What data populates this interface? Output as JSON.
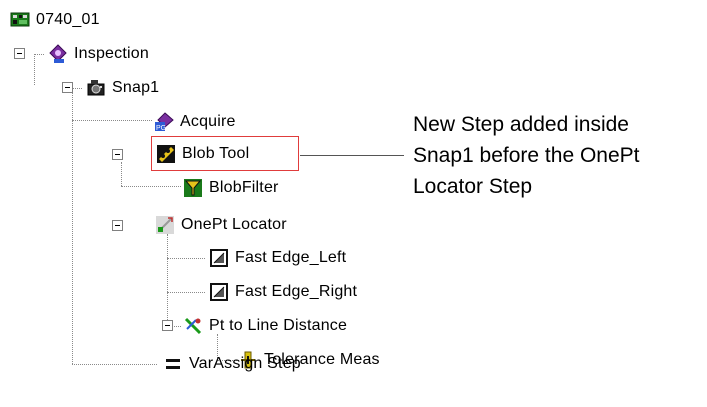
{
  "tree": {
    "root": {
      "label": "0740_01",
      "icon": "board-icon"
    },
    "inspection": {
      "label": "Inspection",
      "icon": "inspection-icon"
    },
    "snap1": {
      "label": "Snap1",
      "icon": "camera-icon"
    },
    "acquire": {
      "label": "Acquire",
      "icon": "acquire-icon"
    },
    "blob_tool": {
      "label": "Blob Tool",
      "icon": "blob-tool-icon"
    },
    "blob_filter": {
      "label": "BlobFilter",
      "icon": "blob-filter-icon"
    },
    "onept_locator": {
      "label": "OnePt Locator",
      "icon": "locator-icon"
    },
    "fast_edge_left": {
      "label": "Fast Edge_Left",
      "icon": "edge-icon"
    },
    "fast_edge_right": {
      "label": "Fast Edge_Right",
      "icon": "edge-icon"
    },
    "pt_to_line": {
      "label": "Pt to Line Distance",
      "icon": "distance-icon"
    },
    "tolerance_meas": {
      "label": "Tolerance Meas",
      "icon": "tolerance-icon"
    },
    "var_assign": {
      "label": "VarAssign Step",
      "icon": "equals-icon"
    }
  },
  "callout": {
    "lines": [
      "New Step added inside",
      "Snap1 before the OnePt",
      "Locator Step"
    ]
  },
  "colors": {
    "highlight": "#e03c3c"
  }
}
